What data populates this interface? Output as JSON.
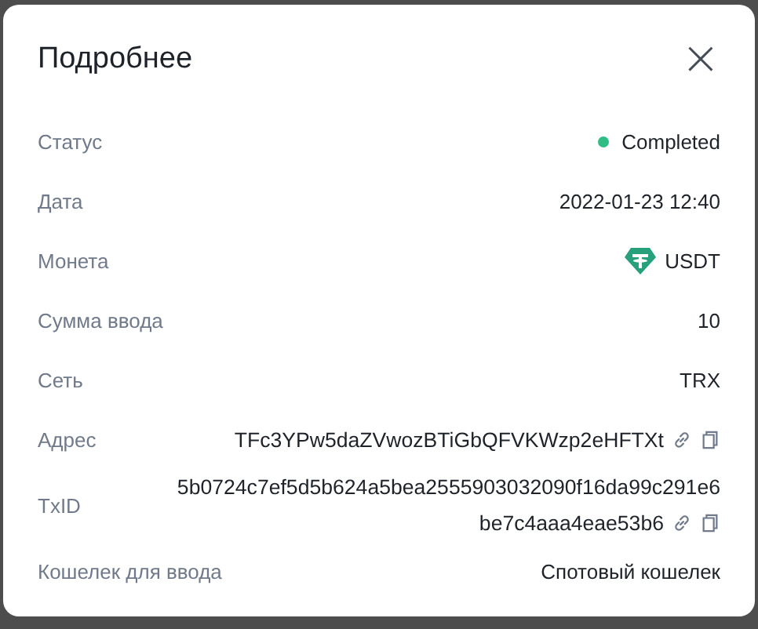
{
  "dialog": {
    "title": "Подробнее",
    "close": "×"
  },
  "rows": [
    {
      "kind": "status",
      "label": "Статус",
      "value": "Completed",
      "color": "#2ebd85"
    },
    {
      "kind": "text",
      "label": "Дата",
      "value": "2022-01-23 12:40"
    },
    {
      "kind": "coin",
      "label": "Монета",
      "value": "USDT"
    },
    {
      "kind": "text",
      "label": "Сумма ввода",
      "value": "10"
    },
    {
      "kind": "text",
      "label": "Сеть",
      "value": "TRX"
    },
    {
      "kind": "hash",
      "label": "Адрес",
      "value": "TFc3YPw5daZVwozBTiGbQFVKWzp2eHFTXt"
    },
    {
      "kind": "hash",
      "label": "TxID",
      "value": "5b0724c7ef5d5b624a5bea2555903032090f16da99c291e6be7c4aaa4eae53b6"
    },
    {
      "kind": "text",
      "label": "Кошелек для ввода",
      "value": "Спотовый кошелек"
    }
  ]
}
